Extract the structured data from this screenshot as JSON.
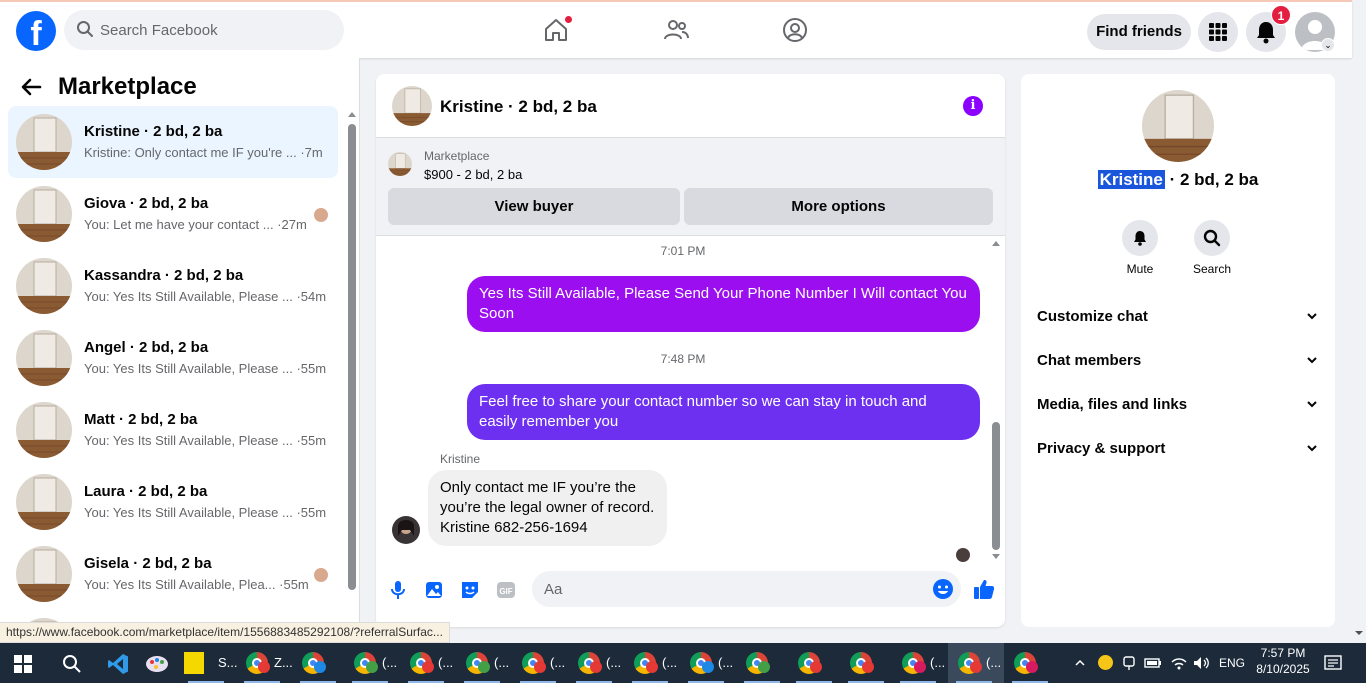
{
  "topbar": {
    "search_placeholder": "Search Facebook",
    "find_friends": "Find friends",
    "notification_count": "1"
  },
  "sidebar": {
    "title": "Marketplace",
    "conversations": [
      {
        "name": "Kristine · 2 bd, 2 ba",
        "preview": "Kristine: Only contact me IF you're ... ·7m",
        "active": true
      },
      {
        "name": "Giova · 2 bd, 2 ba",
        "preview": "You: Let me have your contact ... ·27m"
      },
      {
        "name": "Kassandra · 2 bd, 2 ba",
        "preview": "You: Yes Its Still Available, Please ... ·54m"
      },
      {
        "name": "Angel · 2 bd, 2 ba",
        "preview": "You: Yes Its Still Available, Please ... ·55m"
      },
      {
        "name": "Matt · 2 bd, 2 ba",
        "preview": "You: Yes Its Still Available, Please ... ·55m"
      },
      {
        "name": "Laura · 2 bd, 2 ba",
        "preview": "You: Yes Its Still Available, Please ... ·55m"
      },
      {
        "name": "Gisela · 2 bd, 2 ba",
        "preview": "You: Yes Its Still Available, Plea... ·55m"
      }
    ]
  },
  "chat": {
    "title": "Kristine · 2 bd, 2 ba",
    "marketplace_label": "Marketplace",
    "listing": "$900 - 2 bd, 2 ba",
    "view_buyer": "View buyer",
    "more_options": "More options",
    "messages": [
      {
        "time": "7:01 PM",
        "text": "Yes Its Still Available, Please Send Your Phone Number I Will contact You Soon"
      },
      {
        "time": "7:48 PM",
        "text": "Feel free to share your contact number so we can stay in touch and easily remember you"
      }
    ],
    "incoming": {
      "sender": "Kristine",
      "lines": [
        "Only contact me IF you’re the",
        "you’re the legal owner of record.",
        "Kristine 682-256-1694"
      ]
    },
    "composer_placeholder": "Aa"
  },
  "details": {
    "name_highlight": "Kristine",
    "name_rest": " · 2 bd, 2 ba",
    "mute": "Mute",
    "search": "Search",
    "sections": [
      "Customize chat",
      "Chat members",
      "Media, files and links",
      "Privacy & support"
    ]
  },
  "status_url": "https://www.facebook.com/marketplace/item/1556883485292108/?referralSurfac...",
  "taskbar": {
    "apps": [
      {
        "label": "S..."
      },
      {
        "label": "Z..."
      },
      {
        "label": ""
      },
      {
        "label": "(..."
      },
      {
        "label": "(..."
      },
      {
        "label": "(..."
      },
      {
        "label": "(..."
      },
      {
        "label": "(..."
      },
      {
        "label": "(..."
      },
      {
        "label": "(..."
      },
      {
        "label": ""
      },
      {
        "label": ""
      },
      {
        "label": ""
      },
      {
        "label": "(..."
      },
      {
        "label": "(..."
      },
      {
        "label": ""
      }
    ],
    "language": "ENG",
    "time": "7:57 PM",
    "date": "8/10/2025"
  },
  "colors": {
    "brand": "#0866ff",
    "bubble_1": "#9b0ef0",
    "bubble_2": "#6d30f0",
    "accent_purple": "#8b00ff"
  }
}
